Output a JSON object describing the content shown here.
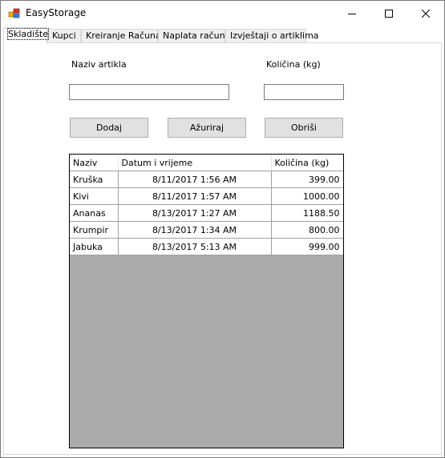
{
  "window": {
    "title": "EasyStorage"
  },
  "tabs": [
    {
      "label": "Skladište",
      "active": true
    },
    {
      "label": "Kupci",
      "active": false
    },
    {
      "label": "Kreiranje Računa",
      "active": false
    },
    {
      "label": "Naplata računa",
      "active": false
    },
    {
      "label": "Izvještaji o artiklima",
      "active": false
    }
  ],
  "form": {
    "name_label": "Naziv artikla",
    "quantity_label": "Količina (kg)",
    "name_value": "",
    "quantity_value": "",
    "add_label": "Dodaj",
    "update_label": "Ažuriraj",
    "delete_label": "Obriši"
  },
  "grid": {
    "headers": [
      "Naziv",
      "Datum i vrijeme",
      "Količina (kg)"
    ],
    "rows": [
      {
        "name": "Kruška",
        "datetime": "8/11/2017 1:56 AM",
        "qty": "399.00"
      },
      {
        "name": "Kivi",
        "datetime": "8/11/2017 1:57 AM",
        "qty": "1000.00"
      },
      {
        "name": "Ananas",
        "datetime": "8/13/2017 1:27 AM",
        "qty": "1188.50"
      },
      {
        "name": "Krumpir",
        "datetime": "8/13/2017 1:34 AM",
        "qty": "800.00"
      },
      {
        "name": "Jabuka",
        "datetime": "8/13/2017 5:13 AM",
        "qty": "999.00"
      }
    ]
  },
  "colors": {
    "grid_empty": "#ababab",
    "button_face": "#e1e1e1"
  }
}
